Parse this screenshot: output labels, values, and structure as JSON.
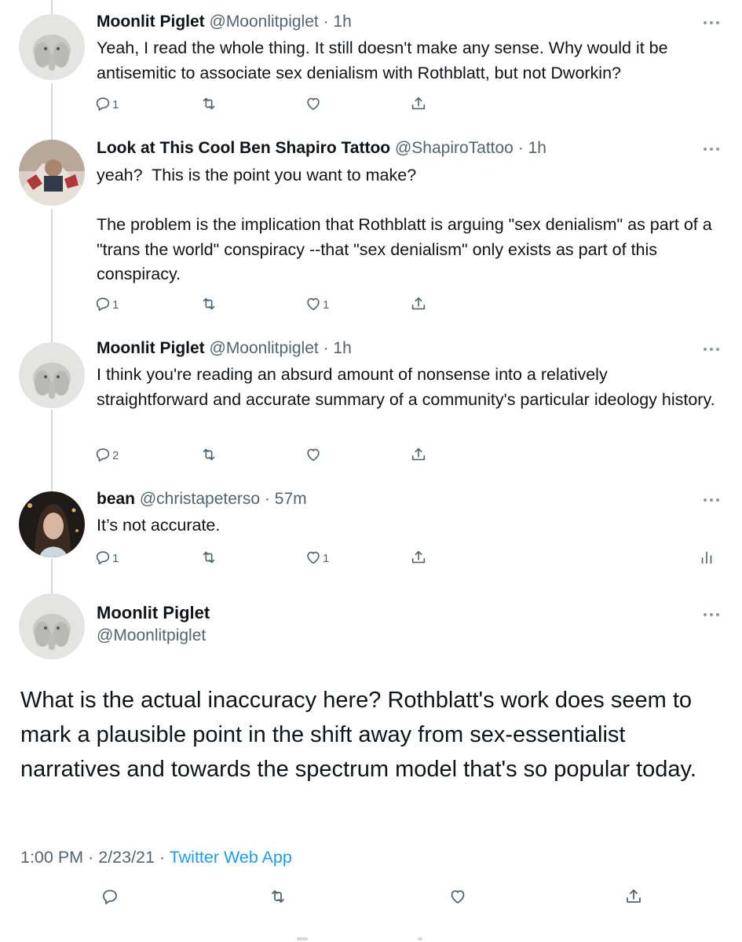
{
  "colors": {
    "text": "#0f1419",
    "secondary": "#536471",
    "accent": "#1d9bf0",
    "thread_line": "#cfd9de"
  },
  "icons": {
    "reply": "reply-icon",
    "retweet": "retweet-icon",
    "like": "like-icon",
    "share": "share-icon",
    "more": "more-icon",
    "analytics": "analytics-icon"
  },
  "replies": [
    {
      "name": "Moonlit Piglet",
      "handle": "@Moonlitpiglet",
      "sep": "·",
      "time": "1h",
      "text": "Yeah, I read the whole thing. It still doesn't make any sense. Why would it be antisemitic to associate sex denialism with Rothblatt, but not Dworkin?",
      "reply_count": "1",
      "like_count": ""
    },
    {
      "name": "Look at This Cool Ben Shapiro Tattoo",
      "handle": "@ShapiroTattoo",
      "sep": "·",
      "time": "1h",
      "text": "yeah?  This is the point you want to make?\n\nThe problem is the implication that Rothblatt is arguing \"sex denialism\" as part of a \"trans the world\" conspiracy --that \"sex denialism\" only exists as part of this conspiracy.",
      "reply_count": "1",
      "like_count": "1"
    },
    {
      "name": "Moonlit Piglet",
      "handle": "@Moonlitpiglet",
      "sep": "·",
      "time": "1h",
      "text": "I think you're reading an absurd amount of nonsense into a relatively straightforward and accurate summary of a community's particular ideology history.",
      "reply_count": "2",
      "like_count": ""
    },
    {
      "name": "bean",
      "handle": "@christapeterso",
      "sep": "·",
      "time": "57m",
      "text": "It’s not accurate.",
      "reply_count": "1",
      "like_count": "1"
    }
  ],
  "main_tweet": {
    "name": "Moonlit Piglet",
    "handle": "@Moonlitpiglet",
    "text": "What is the actual inaccuracy here? Rothblatt's work does seem to mark a plausible point in the shift away from sex-essentialist narratives and towards the spectrum model that's so popular today.",
    "time": "1:00 PM",
    "date": "2/23/21",
    "sep": "·",
    "app": "Twitter Web App"
  }
}
